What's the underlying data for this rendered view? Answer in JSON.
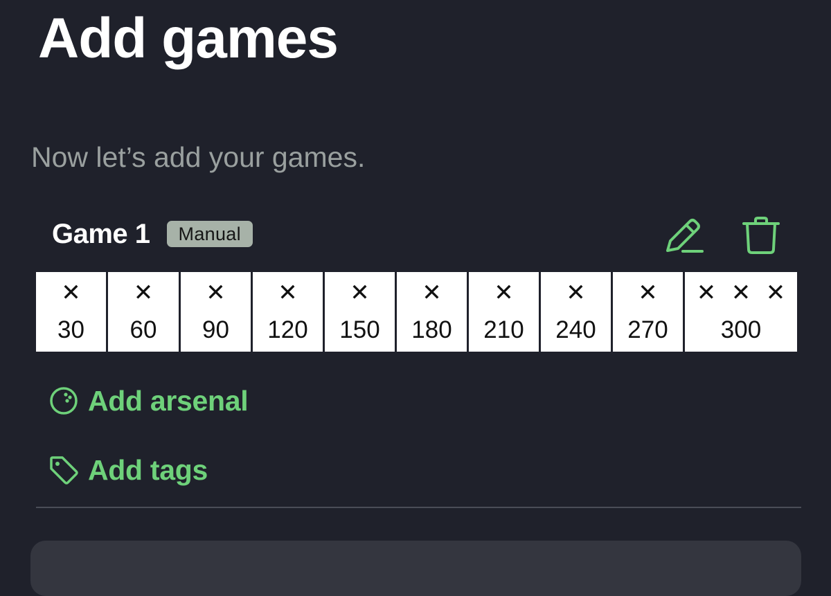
{
  "page": {
    "title": "Add games",
    "subtitle": "Now let’s add your games."
  },
  "game": {
    "name": "Game 1",
    "badge": "Manual",
    "edit_icon": "pencil-icon",
    "delete_icon": "trash-icon",
    "frames": [
      {
        "marks": [
          "X"
        ],
        "total": "30"
      },
      {
        "marks": [
          "X"
        ],
        "total": "60"
      },
      {
        "marks": [
          "X"
        ],
        "total": "90"
      },
      {
        "marks": [
          "X"
        ],
        "total": "120"
      },
      {
        "marks": [
          "X"
        ],
        "total": "150"
      },
      {
        "marks": [
          "X"
        ],
        "total": "180"
      },
      {
        "marks": [
          "X"
        ],
        "total": "210"
      },
      {
        "marks": [
          "X"
        ],
        "total": "240"
      },
      {
        "marks": [
          "X"
        ],
        "total": "270"
      },
      {
        "marks": [
          "X",
          "X",
          "X"
        ],
        "total": "300"
      }
    ]
  },
  "actions": {
    "arsenal": {
      "label": "Add arsenal",
      "icon": "bowling-ball-icon"
    },
    "tags": {
      "label": "Add tags",
      "icon": "tag-icon"
    }
  },
  "colors": {
    "background": "#1f212b",
    "accent": "#6ed17a",
    "badge": "#a7b2a8",
    "muted_text": "#9aa09f"
  }
}
